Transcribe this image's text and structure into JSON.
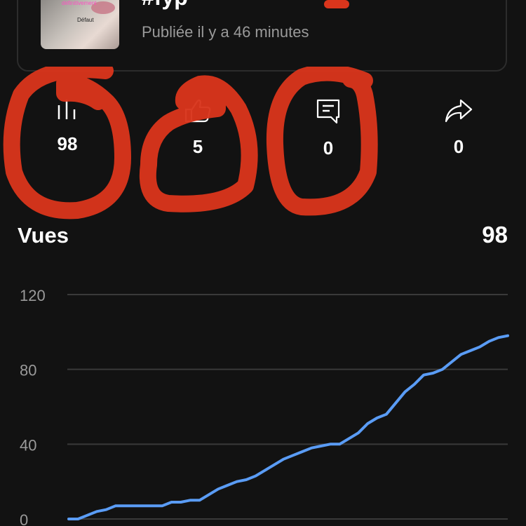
{
  "post": {
    "title": "#fyp",
    "published": "Publiée il y a 46 minutes",
    "thumbnail_texts": [
      "définitivement",
      "Défaut"
    ]
  },
  "stats": [
    {
      "icon": "bar-chart-icon",
      "value": "98"
    },
    {
      "icon": "thumbs-up-icon",
      "value": "5"
    },
    {
      "icon": "comment-icon",
      "value": "0"
    },
    {
      "icon": "share-icon",
      "value": "0"
    }
  ],
  "views": {
    "label": "Vues",
    "total": "98"
  },
  "colors": {
    "background": "#121212",
    "line": "#5a9cf5",
    "annotation": "#d9351c"
  },
  "chart_data": {
    "type": "line",
    "title": "",
    "xlabel": "",
    "ylabel": "",
    "ylim": [
      0,
      120
    ],
    "yticks": [
      0,
      40,
      80,
      120
    ],
    "grid": true,
    "series": [
      {
        "name": "",
        "values": [
          0,
          0,
          2,
          4,
          5,
          7,
          7,
          7,
          7,
          7,
          7,
          9,
          9,
          10,
          10,
          13,
          16,
          18,
          20,
          21,
          23,
          26,
          29,
          32,
          34,
          36,
          38,
          39,
          40,
          40,
          43,
          46,
          51,
          54,
          56,
          62,
          68,
          72,
          77,
          78,
          80,
          84,
          88,
          90,
          92,
          95,
          97,
          98
        ]
      }
    ]
  }
}
